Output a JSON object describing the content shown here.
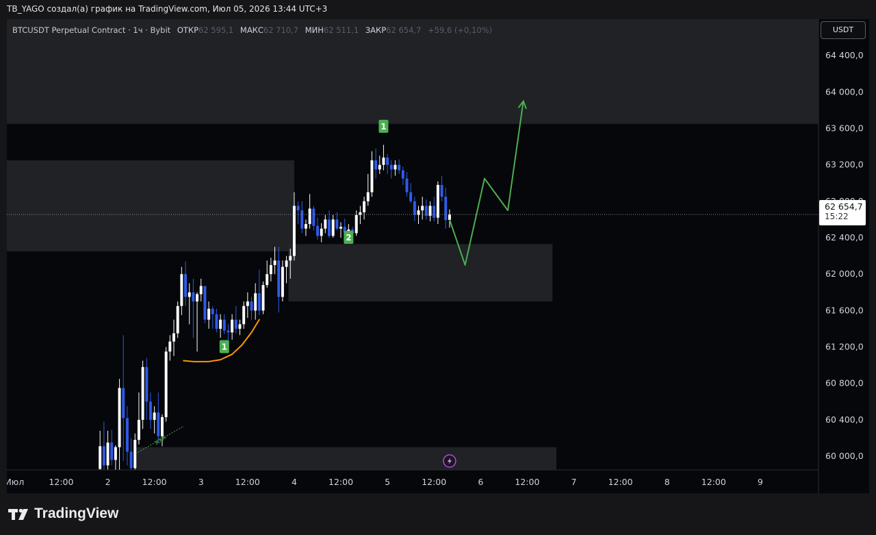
{
  "header": {
    "attribution": "TB_YAGO создал(а) график на TradingView.com, Июл 05, 2026 13:44 UTC+3"
  },
  "symbol": {
    "name": "BTCUSDT Perpetual Contract",
    "interval": "1ч",
    "exchange": "Bybit",
    "open_label": "ОТКР",
    "open_value": "62 595,1",
    "high_label": "МАКС",
    "high_value": "62 710,7",
    "low_label": "МИН",
    "low_value": "62 511,1",
    "close_label": "ЗАКР",
    "close_value": "62 654,7",
    "change": "+59,6 (+0,10%)"
  },
  "price_axis": {
    "unit": "USDT"
  },
  "current_price": {
    "value": "62 654,7",
    "countdown": "15:22"
  },
  "brand": {
    "name": "TradingView"
  },
  "colors": {
    "background": "#06070a",
    "candle_up": "#ffffff",
    "candle_down": "#2f5be7",
    "zone": "#26272b",
    "projection": "#4caf50",
    "curve": "#ff9800",
    "marker": "#4caf50"
  },
  "chart_data": {
    "type": "candlestick",
    "y_ticks": [
      "64 400,0",
      "64 000,0",
      "63 600,0",
      "63 200,0",
      "62 800,0",
      "62 400,0",
      "62 000,0",
      "61 600,0",
      "61 200,0",
      "60 800,0",
      "60 400,0",
      "60 000,0"
    ],
    "y_tick_values": [
      64400,
      64000,
      63600,
      63200,
      62800,
      62400,
      62000,
      61600,
      61200,
      60800,
      60400,
      60000
    ],
    "ylim": [
      59850,
      64800
    ],
    "x_ticks": [
      "Июл",
      "12:00",
      "2",
      "12:00",
      "3",
      "12:00",
      "4",
      "12:00",
      "5",
      "12:00",
      "6",
      "12:00",
      "7",
      "12:00",
      "8",
      "12:00",
      "9"
    ],
    "x_tick_hours": [
      0,
      12,
      24,
      36,
      48,
      60,
      72,
      84,
      96,
      108,
      120,
      132,
      144,
      156,
      168,
      180,
      192
    ],
    "xlim": [
      -2,
      207
    ],
    "candles": [
      {
        "t": 22.0,
        "o": 59860,
        "h": 60280,
        "l": 59850,
        "c": 60110
      },
      {
        "t": 23.0,
        "o": 60110,
        "h": 60380,
        "l": 59850,
        "c": 59900
      },
      {
        "t": 24.0,
        "o": 59900,
        "h": 60280,
        "l": 59850,
        "c": 60150
      },
      {
        "t": 25.0,
        "o": 60150,
        "h": 60290,
        "l": 59900,
        "c": 59960
      },
      {
        "t": 26.0,
        "o": 59960,
        "h": 60120,
        "l": 59850,
        "c": 60100
      },
      {
        "t": 27.0,
        "o": 60100,
        "h": 60850,
        "l": 59850,
        "c": 60750
      },
      {
        "t": 28.0,
        "o": 60750,
        "h": 61330,
        "l": 59950,
        "c": 60420
      },
      {
        "t": 29.0,
        "o": 60420,
        "h": 60550,
        "l": 59900,
        "c": 60050
      },
      {
        "t": 30.0,
        "o": 60050,
        "h": 60200,
        "l": 59850,
        "c": 59870
      },
      {
        "t": 31.0,
        "o": 59870,
        "h": 60250,
        "l": 59850,
        "c": 60180
      },
      {
        "t": 32.0,
        "o": 60180,
        "h": 60700,
        "l": 60130,
        "c": 60400
      },
      {
        "t": 33.0,
        "o": 60400,
        "h": 61050,
        "l": 60300,
        "c": 60980
      },
      {
        "t": 34.0,
        "o": 60980,
        "h": 61080,
        "l": 60400,
        "c": 60600
      },
      {
        "t": 35.0,
        "o": 60600,
        "h": 60700,
        "l": 60300,
        "c": 60400
      },
      {
        "t": 36.0,
        "o": 60400,
        "h": 60550,
        "l": 60250,
        "c": 60480
      },
      {
        "t": 37.0,
        "o": 60480,
        "h": 60700,
        "l": 60150,
        "c": 60220
      },
      {
        "t": 38.0,
        "o": 60220,
        "h": 60460,
        "l": 60110,
        "c": 60430
      },
      {
        "t": 39.0,
        "o": 60430,
        "h": 61200,
        "l": 60380,
        "c": 61150
      },
      {
        "t": 40.0,
        "o": 61150,
        "h": 61330,
        "l": 61050,
        "c": 61260
      },
      {
        "t": 41.0,
        "o": 61260,
        "h": 61500,
        "l": 61100,
        "c": 61350
      },
      {
        "t": 42.0,
        "o": 61350,
        "h": 61700,
        "l": 61300,
        "c": 61650
      },
      {
        "t": 43.0,
        "o": 61650,
        "h": 62080,
        "l": 61550,
        "c": 62000
      },
      {
        "t": 44.0,
        "o": 62000,
        "h": 62140,
        "l": 61650,
        "c": 61750
      },
      {
        "t": 45.0,
        "o": 61750,
        "h": 61900,
        "l": 61450,
        "c": 61800
      },
      {
        "t": 46.0,
        "o": 61800,
        "h": 61950,
        "l": 61300,
        "c": 61700
      },
      {
        "t": 47.0,
        "o": 61700,
        "h": 61800,
        "l": 61150,
        "c": 61780
      },
      {
        "t": 48.0,
        "o": 61780,
        "h": 61950,
        "l": 61700,
        "c": 61870
      },
      {
        "t": 49.0,
        "o": 61870,
        "h": 61870,
        "l": 61460,
        "c": 61500
      },
      {
        "t": 50.0,
        "o": 61500,
        "h": 61700,
        "l": 61400,
        "c": 61620
      },
      {
        "t": 51.0,
        "o": 61620,
        "h": 61650,
        "l": 61400,
        "c": 61560
      },
      {
        "t": 52.0,
        "o": 61560,
        "h": 61620,
        "l": 61360,
        "c": 61400
      },
      {
        "t": 53.0,
        "o": 61400,
        "h": 61560,
        "l": 61300,
        "c": 61500
      },
      {
        "t": 54.0,
        "o": 61500,
        "h": 61560,
        "l": 61340,
        "c": 61380
      },
      {
        "t": 55.0,
        "o": 61380,
        "h": 61450,
        "l": 61220,
        "c": 61360
      },
      {
        "t": 56.0,
        "o": 61360,
        "h": 61560,
        "l": 61280,
        "c": 61500
      },
      {
        "t": 57.0,
        "o": 61500,
        "h": 61650,
        "l": 61350,
        "c": 61400
      },
      {
        "t": 58.0,
        "o": 61400,
        "h": 61500,
        "l": 61330,
        "c": 61450
      },
      {
        "t": 59.0,
        "o": 61450,
        "h": 61700,
        "l": 61400,
        "c": 61650
      },
      {
        "t": 60.0,
        "o": 61650,
        "h": 61800,
        "l": 61520,
        "c": 61700
      },
      {
        "t": 61.0,
        "o": 61700,
        "h": 61750,
        "l": 61500,
        "c": 61600
      },
      {
        "t": 62.0,
        "o": 61600,
        "h": 61900,
        "l": 61500,
        "c": 61790
      },
      {
        "t": 63.0,
        "o": 61790,
        "h": 62050,
        "l": 61550,
        "c": 61600
      },
      {
        "t": 64.0,
        "o": 61600,
        "h": 61920,
        "l": 61560,
        "c": 61880
      },
      {
        "t": 65.0,
        "o": 61880,
        "h": 62150,
        "l": 61850,
        "c": 62000
      },
      {
        "t": 66.0,
        "o": 62000,
        "h": 62180,
        "l": 61920,
        "c": 62100
      },
      {
        "t": 67.0,
        "o": 62100,
        "h": 62300,
        "l": 62000,
        "c": 62150
      },
      {
        "t": 68.0,
        "o": 62150,
        "h": 62300,
        "l": 61580,
        "c": 61750
      },
      {
        "t": 69.0,
        "o": 61750,
        "h": 62150,
        "l": 61700,
        "c": 62080
      },
      {
        "t": 70.0,
        "o": 62080,
        "h": 62200,
        "l": 61900,
        "c": 62150
      },
      {
        "t": 71.0,
        "o": 62150,
        "h": 62280,
        "l": 61950,
        "c": 62200
      },
      {
        "t": 72.0,
        "o": 62200,
        "h": 62900,
        "l": 62150,
        "c": 62750
      },
      {
        "t": 73.0,
        "o": 62750,
        "h": 62800,
        "l": 62550,
        "c": 62700
      },
      {
        "t": 74.0,
        "o": 62700,
        "h": 62800,
        "l": 62450,
        "c": 62500
      },
      {
        "t": 75.0,
        "o": 62500,
        "h": 62600,
        "l": 62420,
        "c": 62550
      },
      {
        "t": 76.0,
        "o": 62550,
        "h": 62880,
        "l": 62500,
        "c": 62720
      },
      {
        "t": 77.0,
        "o": 62720,
        "h": 62750,
        "l": 62480,
        "c": 62530
      },
      {
        "t": 78.0,
        "o": 62530,
        "h": 62620,
        "l": 62380,
        "c": 62420
      },
      {
        "t": 79.0,
        "o": 62420,
        "h": 62560,
        "l": 62350,
        "c": 62500
      },
      {
        "t": 80.0,
        "o": 62500,
        "h": 62650,
        "l": 62450,
        "c": 62600
      },
      {
        "t": 81.0,
        "o": 62600,
        "h": 62700,
        "l": 62400,
        "c": 62420
      },
      {
        "t": 82.0,
        "o": 62420,
        "h": 62650,
        "l": 62400,
        "c": 62600
      },
      {
        "t": 83.0,
        "o": 62600,
        "h": 62680,
        "l": 62480,
        "c": 62500
      },
      {
        "t": 84.0,
        "o": 62500,
        "h": 62570,
        "l": 62400,
        "c": 62520
      },
      {
        "t": 85.0,
        "o": 62520,
        "h": 62610,
        "l": 62420,
        "c": 62460
      },
      {
        "t": 86.0,
        "o": 62460,
        "h": 62550,
        "l": 62400,
        "c": 62490
      },
      {
        "t": 87.0,
        "o": 62490,
        "h": 62520,
        "l": 62380,
        "c": 62450
      },
      {
        "t": 88.0,
        "o": 62450,
        "h": 62700,
        "l": 62420,
        "c": 62650
      },
      {
        "t": 89.0,
        "o": 62650,
        "h": 62750,
        "l": 62550,
        "c": 62680
      },
      {
        "t": 90.0,
        "o": 62680,
        "h": 62850,
        "l": 62600,
        "c": 62800
      },
      {
        "t": 91.0,
        "o": 62800,
        "h": 63100,
        "l": 62750,
        "c": 62900
      },
      {
        "t": 92.0,
        "o": 62900,
        "h": 63350,
        "l": 62850,
        "c": 63250
      },
      {
        "t": 93.0,
        "o": 63250,
        "h": 63380,
        "l": 63050,
        "c": 63150
      },
      {
        "t": 94.0,
        "o": 63150,
        "h": 63300,
        "l": 63100,
        "c": 63200
      },
      {
        "t": 95.0,
        "o": 63200,
        "h": 63420,
        "l": 63140,
        "c": 63280
      },
      {
        "t": 96.0,
        "o": 63280,
        "h": 63320,
        "l": 63100,
        "c": 63200
      },
      {
        "t": 97.0,
        "o": 63200,
        "h": 63250,
        "l": 63050,
        "c": 63150
      },
      {
        "t": 98.0,
        "o": 63150,
        "h": 63250,
        "l": 63080,
        "c": 63200
      },
      {
        "t": 99.0,
        "o": 63200,
        "h": 63260,
        "l": 63100,
        "c": 63140
      },
      {
        "t": 100.0,
        "o": 63140,
        "h": 63180,
        "l": 62980,
        "c": 63050
      },
      {
        "t": 101.0,
        "o": 63050,
        "h": 63120,
        "l": 62850,
        "c": 62900
      },
      {
        "t": 102.0,
        "o": 62900,
        "h": 63000,
        "l": 62780,
        "c": 62800
      },
      {
        "t": 103.0,
        "o": 62800,
        "h": 62850,
        "l": 62580,
        "c": 62650
      },
      {
        "t": 104.0,
        "o": 62650,
        "h": 62750,
        "l": 62550,
        "c": 62700
      },
      {
        "t": 105.0,
        "o": 62700,
        "h": 62850,
        "l": 62600,
        "c": 62750
      },
      {
        "t": 106.0,
        "o": 62750,
        "h": 62820,
        "l": 62600,
        "c": 62640
      },
      {
        "t": 107.0,
        "o": 62640,
        "h": 62800,
        "l": 62580,
        "c": 62750
      },
      {
        "t": 108.0,
        "o": 62750,
        "h": 62850,
        "l": 62580,
        "c": 62620
      },
      {
        "t": 109.0,
        "o": 62620,
        "h": 63020,
        "l": 62550,
        "c": 62980
      },
      {
        "t": 110.0,
        "o": 62980,
        "h": 63080,
        "l": 62800,
        "c": 62850
      },
      {
        "t": 111.0,
        "o": 62850,
        "h": 62950,
        "l": 62500,
        "c": 62595
      },
      {
        "t": 112.0,
        "o": 62595,
        "h": 62710.7,
        "l": 62511.1,
        "c": 62654.7
      }
    ],
    "zones": [
      {
        "t1": -2,
        "t2": 207,
        "y1": 63650,
        "y2": 64800
      },
      {
        "t1": -2,
        "t2": 72,
        "y1": 62250,
        "y2": 63250
      },
      {
        "t1": 70.5,
        "t2": 138.5,
        "y1": 61700,
        "y2": 62330
      },
      {
        "t1": 31,
        "t2": 139.5,
        "y1": 59850,
        "y2": 60100
      }
    ],
    "projection_path": [
      [
        112,
        62600
      ],
      [
        116,
        62100
      ],
      [
        121,
        63050
      ],
      [
        127,
        62700
      ],
      [
        131,
        63900
      ]
    ],
    "curve_path": [
      [
        43.5,
        61050
      ],
      [
        46,
        61040
      ],
      [
        50,
        61040
      ],
      [
        53,
        61060
      ],
      [
        56,
        61120
      ],
      [
        58.5,
        61220
      ],
      [
        61,
        61360
      ],
      [
        63,
        61500
      ]
    ],
    "markers": [
      {
        "label": "1",
        "t": 54,
        "price": 61200
      },
      {
        "label": "2",
        "t": 86,
        "price": 62400
      },
      {
        "label": "1",
        "t": 95,
        "price": 63620
      }
    ],
    "annotation": {
      "text": "XXX",
      "t": 36.5,
      "price": 60120
    },
    "current_price_value": 62654.7
  }
}
